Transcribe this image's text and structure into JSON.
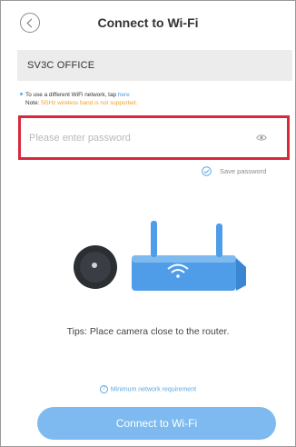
{
  "header": {
    "title": "Connect to Wi-Fi",
    "back_icon": "chevron-left-icon"
  },
  "network": {
    "ssid": "SV3C OFFICE"
  },
  "hint": {
    "line1_prefix": "To use a different WiFi network, tap ",
    "line1_link": "here",
    "note_label": "Note: ",
    "note_warning": "5GHz wireless band is not supported."
  },
  "password": {
    "placeholder": "Please enter password",
    "value": "",
    "toggle_icon": "eye-icon"
  },
  "save_password": {
    "label": "Save password",
    "checked": true
  },
  "tips": {
    "text": "Tips: Place camera close to the router."
  },
  "requirement_link": {
    "icon": "?",
    "label": "Minimum network requirement"
  },
  "connect_button": {
    "label": "Connect to Wi-Fi"
  },
  "colors": {
    "accent": "#7ebaf0",
    "link": "#4a9be0",
    "warning": "#f0a02c",
    "highlight_border": "#d8293b"
  }
}
